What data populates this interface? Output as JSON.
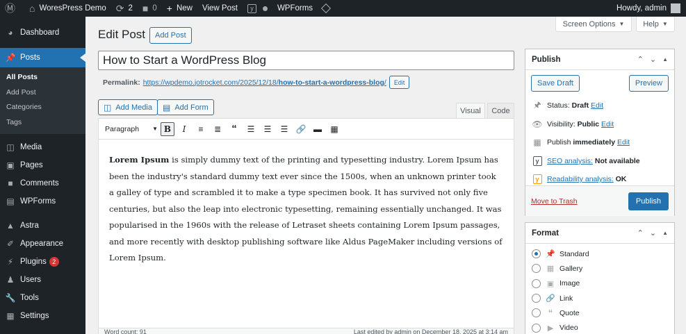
{
  "adminbar": {
    "site_name": "WoresPress Demo",
    "updates_count": "2",
    "comments_count": "0",
    "new_label": "New",
    "view_post_label": "View Post",
    "wpforms_label": "WPForms",
    "greeting": "Howdy, admin"
  },
  "sidebar": {
    "items": [
      {
        "label": "Dashboard",
        "icon": "dashboard-icon"
      },
      {
        "label": "Posts",
        "icon": "pin-icon"
      },
      {
        "label": "Media",
        "icon": "media-icon"
      },
      {
        "label": "Pages",
        "icon": "pages-icon"
      },
      {
        "label": "Comments",
        "icon": "comment-icon"
      },
      {
        "label": "WPForms",
        "icon": "wpforms-icon"
      },
      {
        "label": "Astra",
        "icon": "astra-icon"
      },
      {
        "label": "Appearance",
        "icon": "brush-icon"
      },
      {
        "label": "Plugins",
        "icon": "plugin-icon",
        "badge": "2"
      },
      {
        "label": "Users",
        "icon": "users-icon"
      },
      {
        "label": "Tools",
        "icon": "wrench-icon"
      },
      {
        "label": "Settings",
        "icon": "settings-icon"
      }
    ],
    "posts_submenu": [
      "All Posts",
      "Add Post",
      "Categories",
      "Tags"
    ]
  },
  "screen_options_label": "Screen Options",
  "help_label": "Help",
  "page": {
    "title": "Edit Post",
    "add_post_label": "Add Post"
  },
  "post": {
    "title": "How to Start a WordPress Blog",
    "permalink_label": "Permalink:",
    "permalink_base": "https://wpdemo.jotrocket.com/2025/12/18/",
    "permalink_slug": "how-to-start-a-wordpress-blog",
    "permalink_end": "/",
    "permalink_edit": "Edit"
  },
  "media_buttons": {
    "add_media": "Add Media",
    "add_form": "Add Form"
  },
  "editor_tabs": {
    "visual": "Visual",
    "code": "Code"
  },
  "toolbar": {
    "format_select": "Paragraph"
  },
  "content": {
    "bold_lead": "Lorem Ipsum",
    "body": " is simply dummy text of the printing and typesetting industry. Lorem Ipsum has been the industry's standard dummy text ever since the 1500s, when an unknown printer took a galley of type and scrambled it to make a type specimen book. It has survived not only five centuries, but also the leap into electronic typesetting, remaining essentially unchanged. It was popularised in the 1960s with the release of Letraset sheets containing Lorem Ipsum passages, and more recently with desktop publishing software like Aldus PageMaker including versions of Lorem Ipsum."
  },
  "statusbar": {
    "word_count": "Word count: 91",
    "last_edited": "Last edited by admin on December 18, 2025 at 3:14 am"
  },
  "publish_box": {
    "title": "Publish",
    "save_draft": "Save Draft",
    "preview": "Preview",
    "status_label": "Status:",
    "status_value": "Draft",
    "visibility_label": "Visibility:",
    "visibility_value": "Public",
    "publish_label": "Publish",
    "publish_value": "immediately",
    "edit_label": "Edit",
    "seo_label": "SEO analysis:",
    "seo_value": "Not available",
    "readability_label": "Readability analysis:",
    "readability_value": "OK",
    "move_to_trash": "Move to Trash",
    "publish_button": "Publish",
    "colors": {
      "seo": "#50575e",
      "readability": "#ff9900"
    }
  },
  "format_box": {
    "title": "Format",
    "options": [
      {
        "label": "Standard",
        "icon": "pin-icon",
        "checked": true
      },
      {
        "label": "Gallery",
        "icon": "gallery-icon",
        "checked": false
      },
      {
        "label": "Image",
        "icon": "image-icon",
        "checked": false
      },
      {
        "label": "Link",
        "icon": "link-icon",
        "checked": false
      },
      {
        "label": "Quote",
        "icon": "quote-icon",
        "checked": false
      },
      {
        "label": "Video",
        "icon": "video-icon",
        "checked": false
      }
    ]
  }
}
